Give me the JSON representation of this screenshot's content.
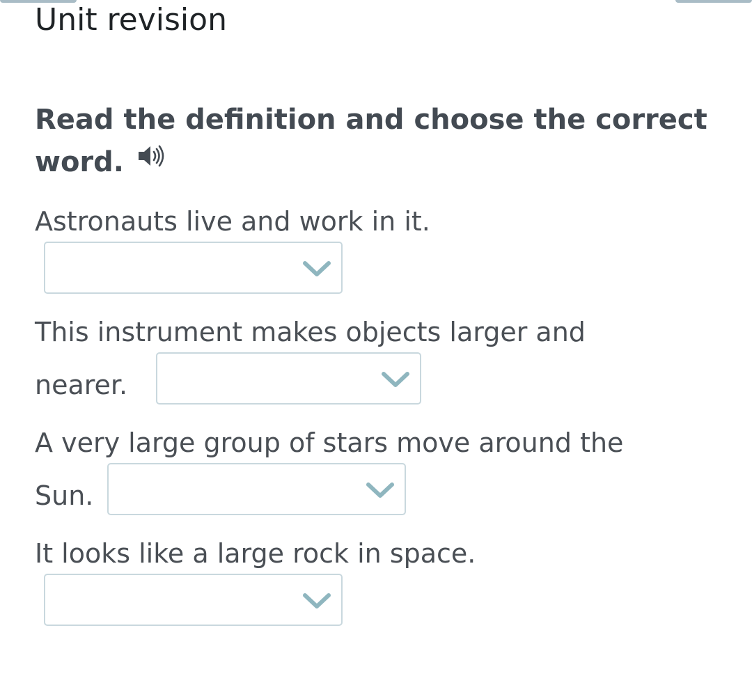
{
  "page": {
    "title": "Unit revision",
    "instruction": "Read the definition and choose the correct word.",
    "audio_icon": "speaker-icon"
  },
  "questions": [
    {
      "text": "Astronauts live and work in it.",
      "selected": ""
    },
    {
      "text_line1": "This instrument makes objects larger and",
      "text_line2": "nearer.",
      "selected": ""
    },
    {
      "text_line1": "A very large group of stars move around the",
      "text_line2": "Sun.",
      "selected": ""
    },
    {
      "text": "It looks like a large rock in space.",
      "selected": ""
    }
  ],
  "colors": {
    "dropdown_border": "#c9d8de",
    "chevron": "#8fb6bf",
    "text": "#4a4f55",
    "tab": "#a9bcc6"
  },
  "icons": {
    "dropdown": "chevron-down-icon"
  }
}
